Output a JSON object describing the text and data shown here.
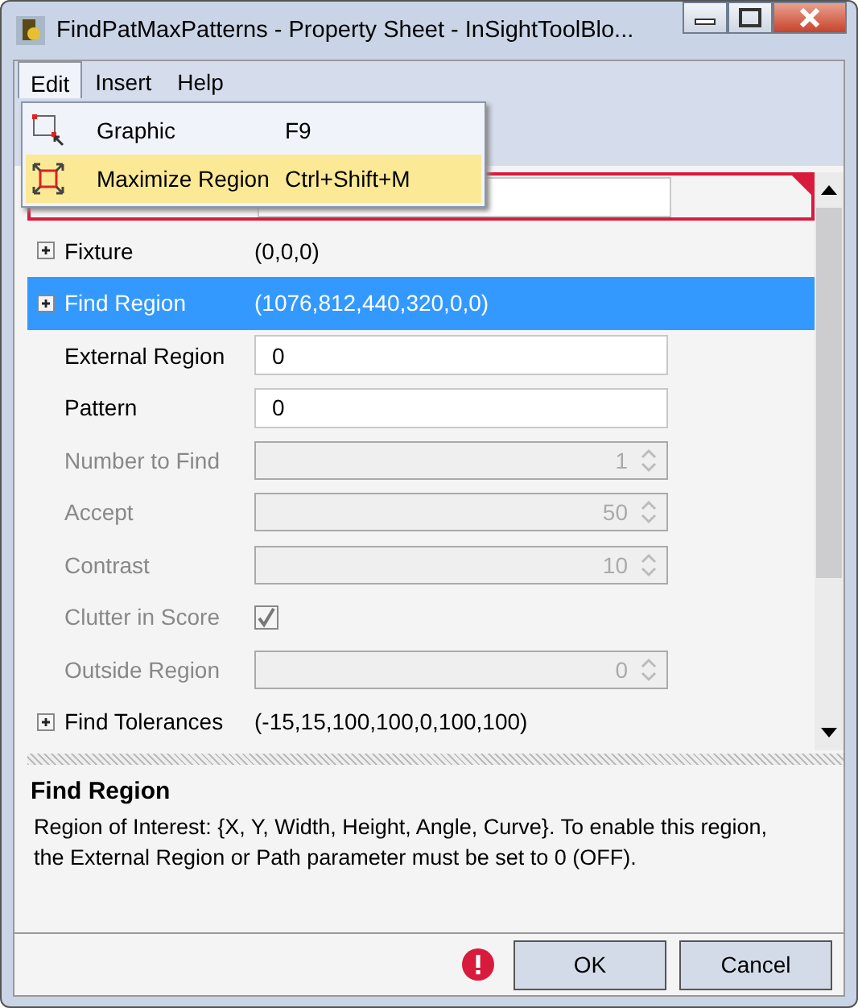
{
  "window": {
    "title": "FindPatMaxPatterns - Property Sheet - InSightToolBlo..."
  },
  "menu": [
    {
      "label": "Edit",
      "selected": true
    },
    {
      "label": "Insert",
      "selected": false
    },
    {
      "label": "Help",
      "selected": false
    }
  ],
  "dropdown": [
    {
      "label": "Graphic",
      "shortcut": "F9",
      "kind": "graphic",
      "selected": false
    },
    {
      "label": "Maximize Region",
      "shortcut": "Ctrl+Shift+M",
      "kind": "maximize",
      "selected": true
    }
  ],
  "grid": [
    {
      "kind": "text",
      "error": true,
      "selected": false
    },
    {
      "kind": "group",
      "label": "Fixture",
      "value": "(0,0,0)",
      "expanded": false,
      "selected": false
    },
    {
      "kind": "group",
      "label": "Find Region",
      "value": "(1076,812,440,320,0,0)",
      "expanded": false,
      "selected": true
    },
    {
      "kind": "text",
      "label": "External Region",
      "value": "0",
      "disabled": false,
      "selected": false
    },
    {
      "kind": "text",
      "label": "Pattern",
      "value": "0",
      "disabled": false,
      "selected": false
    },
    {
      "kind": "spin",
      "label": "Number to Find",
      "value": "1",
      "disabled": true,
      "selected": false
    },
    {
      "kind": "spin",
      "label": "Accept",
      "value": "50",
      "disabled": true,
      "selected": false
    },
    {
      "kind": "spin",
      "label": "Contrast",
      "value": "10",
      "disabled": true,
      "selected": false
    },
    {
      "kind": "check",
      "label": "Clutter in Score",
      "checked": true,
      "disabled": true,
      "selected": false
    },
    {
      "kind": "spin",
      "label": "Outside Region",
      "value": "0",
      "disabled": true,
      "selected": false
    },
    {
      "kind": "group",
      "label": "Find Tolerances",
      "value": "(-15,15,100,100,0,100,100)",
      "expanded": false,
      "selected": false
    }
  ],
  "description": {
    "title": "Find Region",
    "text": "Region of Interest: {X, Y, Width, Height, Angle, Curve}. To enable this region, the External Region or Path parameter must be set to 0 (OFF)."
  },
  "status": {
    "error": true
  },
  "buttons": [
    "OK",
    "Cancel"
  ]
}
